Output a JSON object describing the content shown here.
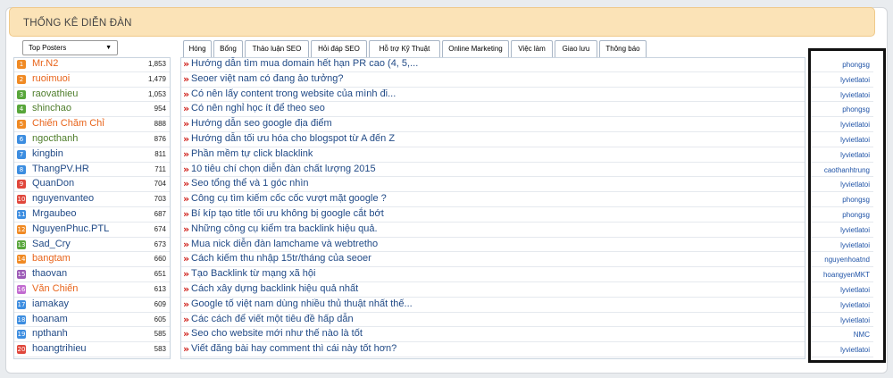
{
  "header": {
    "title": "THỐNG KÊ DIỄN ĐÀN"
  },
  "top_posters": {
    "select_label": "Top Posters",
    "users": [
      {
        "rank": "1",
        "name": "Mr.N2",
        "count": "1,853",
        "color": "#e8641b",
        "icon_bg": "#f08a24"
      },
      {
        "rank": "2",
        "name": "ruoimuoi",
        "count": "1,479",
        "color": "#e8641b",
        "icon_bg": "#f08a24"
      },
      {
        "rank": "3",
        "name": "raovathieu",
        "count": "1,053",
        "color": "#4e7d2b",
        "icon_bg": "#58a63b"
      },
      {
        "rank": "4",
        "name": "shinchao",
        "count": "954",
        "color": "#4e7d2b",
        "icon_bg": "#58a63b"
      },
      {
        "rank": "5",
        "name": "Chiến Chăm Chỉ",
        "count": "888",
        "color": "#e8641b",
        "icon_bg": "#f08a24"
      },
      {
        "rank": "6",
        "name": "ngocthanh",
        "count": "876",
        "color": "#4e7d2b",
        "icon_bg": "#3c8de0"
      },
      {
        "rank": "7",
        "name": "kingbin",
        "count": "811",
        "color": "#224b87",
        "icon_bg": "#3c8de0"
      },
      {
        "rank": "8",
        "name": "ThangPV.HR",
        "count": "711",
        "color": "#224b87",
        "icon_bg": "#3c8de0"
      },
      {
        "rank": "9",
        "name": "QuanDon",
        "count": "704",
        "color": "#224b87",
        "icon_bg": "#e0473c"
      },
      {
        "rank": "10",
        "name": "nguyenvanteo",
        "count": "703",
        "color": "#224b87",
        "icon_bg": "#e0473c"
      },
      {
        "rank": "11",
        "name": "Mrgaubeo",
        "count": "687",
        "color": "#224b87",
        "icon_bg": "#3c8de0"
      },
      {
        "rank": "12",
        "name": "NguyenPhuc.PTL",
        "count": "674",
        "color": "#224b87",
        "icon_bg": "#f08a24"
      },
      {
        "rank": "13",
        "name": "Sad_Cry",
        "count": "673",
        "color": "#224b87",
        "icon_bg": "#58a63b"
      },
      {
        "rank": "14",
        "name": "bangtam",
        "count": "660",
        "color": "#e8641b",
        "icon_bg": "#f08a24"
      },
      {
        "rank": "15",
        "name": "thaovan",
        "count": "651",
        "color": "#224b87",
        "icon_bg": "#9b59b6"
      },
      {
        "rank": "16",
        "name": "Văn Chiến",
        "count": "613",
        "color": "#e8641b",
        "icon_bg": "#c26bd0"
      },
      {
        "rank": "17",
        "name": "iamakay",
        "count": "609",
        "color": "#224b87",
        "icon_bg": "#3c8de0"
      },
      {
        "rank": "18",
        "name": "hoanam",
        "count": "605",
        "color": "#224b87",
        "icon_bg": "#3c8de0"
      },
      {
        "rank": "19",
        "name": "npthanh",
        "count": "585",
        "color": "#224b87",
        "icon_bg": "#3c8de0"
      },
      {
        "rank": "20",
        "name": "hoangtrihieu",
        "count": "583",
        "color": "#224b87",
        "icon_bg": "#e0473c"
      }
    ]
  },
  "tabs": [
    {
      "label": "Hóng",
      "active": true
    },
    {
      "label": "Bổng"
    },
    {
      "label": "Thảo luận SEO"
    },
    {
      "label": "Hỏi đáp SEO"
    },
    {
      "label": "Hỗ trợ Kỹ Thuật"
    },
    {
      "label": "Online Marketing"
    },
    {
      "label": "Việc làm"
    },
    {
      "label": "Giao lưu"
    },
    {
      "label": "Thông báo"
    }
  ],
  "threads": [
    {
      "title": "Hướng dẫn tìm mua domain hết hạn PR cao (4, 5,...",
      "author": "phongsg"
    },
    {
      "title": "Seoer việt nam có đang ảo tưởng?",
      "author": "lyvietlatoi"
    },
    {
      "title": "Có nên lấy content trong website của mình đi...",
      "author": "lyvietlatoi"
    },
    {
      "title": "Có nên nghỉ học ít để theo seo",
      "author": "phongsg"
    },
    {
      "title": "Hướng dẫn seo google địa điểm",
      "author": "lyvietlatoi"
    },
    {
      "title": "Hướng dẫn tối ưu hóa cho blogspot từ A đến Z",
      "author": "lyvietlatoi"
    },
    {
      "title": "Phần mềm tự click blacklink",
      "author": "lyvietlatoi"
    },
    {
      "title": "10 tiêu chí chọn diễn đàn chất lượng 2015",
      "author": "caothanhtrung"
    },
    {
      "title": "Seo tổng thể và 1 góc nhìn",
      "author": "lyvietlatoi"
    },
    {
      "title": "Công cụ tìm kiếm cốc cốc vượt mặt google ?",
      "author": "phongsg"
    },
    {
      "title": "Bí kíp tạo title tối ưu không bị google cắt bớt",
      "author": "phongsg"
    },
    {
      "title": "Những công cụ kiểm tra backlink hiệu quả.",
      "author": "lyvietlatoi"
    },
    {
      "title": "Mua nick diễn đàn lamchame và webtretho",
      "author": "lyvietlatoi"
    },
    {
      "title": "Cách kiếm thu nhập 15tr/tháng của seoer",
      "author": "nguyenhoatnd"
    },
    {
      "title": "Tạo Backlink từ mạng xã hội",
      "author": "hoangyenMKT"
    },
    {
      "title": "Cách xây dựng backlink hiệu quả nhất",
      "author": "lyvietlatoi"
    },
    {
      "title": "Google tố việt nam dùng nhiều thủ thuật nhất thế...",
      "author": "lyvietlatoi"
    },
    {
      "title": "Các cách để viết một tiêu đề hấp dẫn",
      "author": "lyvietlatoi"
    },
    {
      "title": "Seo cho website mới như thế nào là tốt",
      "author": "NMC"
    },
    {
      "title": "Viết đăng bài hay comment thì cái này tốt hơn?",
      "author": "lyvietlatoi"
    }
  ]
}
